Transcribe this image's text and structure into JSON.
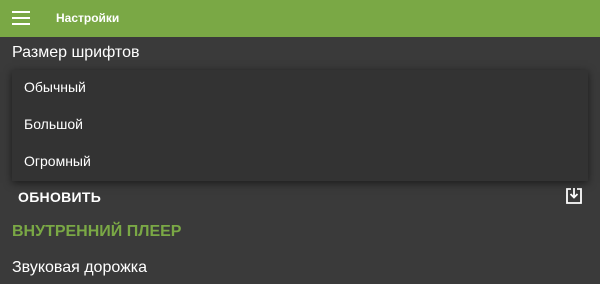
{
  "appbar": {
    "title": "Настройки",
    "color": "#7aa845",
    "menu_icon": "hamburger-menu-icon"
  },
  "settings": {
    "font_size_label": "Размер шрифтов",
    "refresh_label": "ОБНОВИТЬ",
    "refresh_icon": "download-icon",
    "section_header": "ВНУТРЕННИЙ ПЛЕЕР",
    "audio_track_label": "Звуковая дорожка"
  },
  "font_size_dropdown": {
    "options": [
      "Обычный",
      "Большой",
      "Огромный"
    ]
  },
  "colors": {
    "background": "#3a3a3a",
    "dropdown_background": "#333333",
    "accent": "#7aa845",
    "text": "#ffffff"
  }
}
